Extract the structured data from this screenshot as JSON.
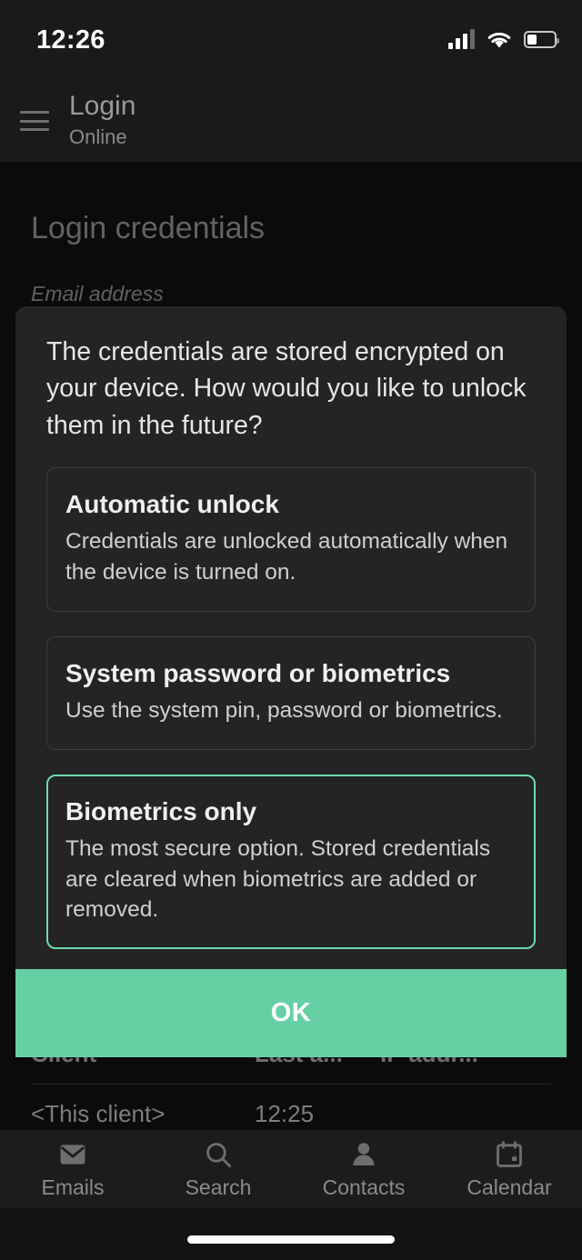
{
  "status_bar": {
    "time": "12:26",
    "signal_icon": "cellular-signal-icon",
    "wifi_icon": "wifi-icon",
    "battery_icon": "battery-icon"
  },
  "app_bar": {
    "menu_icon": "hamburger-menu-icon",
    "title": "Login",
    "subtitle": "Online"
  },
  "page": {
    "heading": "Login credentials",
    "email_label": "Email address"
  },
  "dialog": {
    "message": "The credentials are stored encrypted on your device. How would you like to unlock them in the future?",
    "options": [
      {
        "title": "Automatic unlock",
        "description": "Credentials are unlocked automatically when the device is turned on.",
        "selected": false
      },
      {
        "title": "System password or biometrics",
        "description": "Use the system pin, password or biometrics.",
        "selected": false
      },
      {
        "title": "Biometrics only",
        "description": "The most secure option. Stored credentials are cleared when biometrics are added or removed.",
        "selected": true
      }
    ],
    "confirm_label": "OK",
    "accent_color": "#67cfa4",
    "selected_border_color": "#6ddcac"
  },
  "clients_table": {
    "headers": [
      "Client",
      "Last a...",
      "IP addr..."
    ],
    "rows": [
      {
        "client": "<This client>",
        "last_access": "12:25",
        "ip_address": ""
      }
    ]
  },
  "bottom_nav": {
    "items": [
      {
        "label": "Emails",
        "icon": "envelope-icon"
      },
      {
        "label": "Search",
        "icon": "search-icon"
      },
      {
        "label": "Contacts",
        "icon": "person-icon"
      },
      {
        "label": "Calendar",
        "icon": "calendar-icon"
      }
    ]
  }
}
